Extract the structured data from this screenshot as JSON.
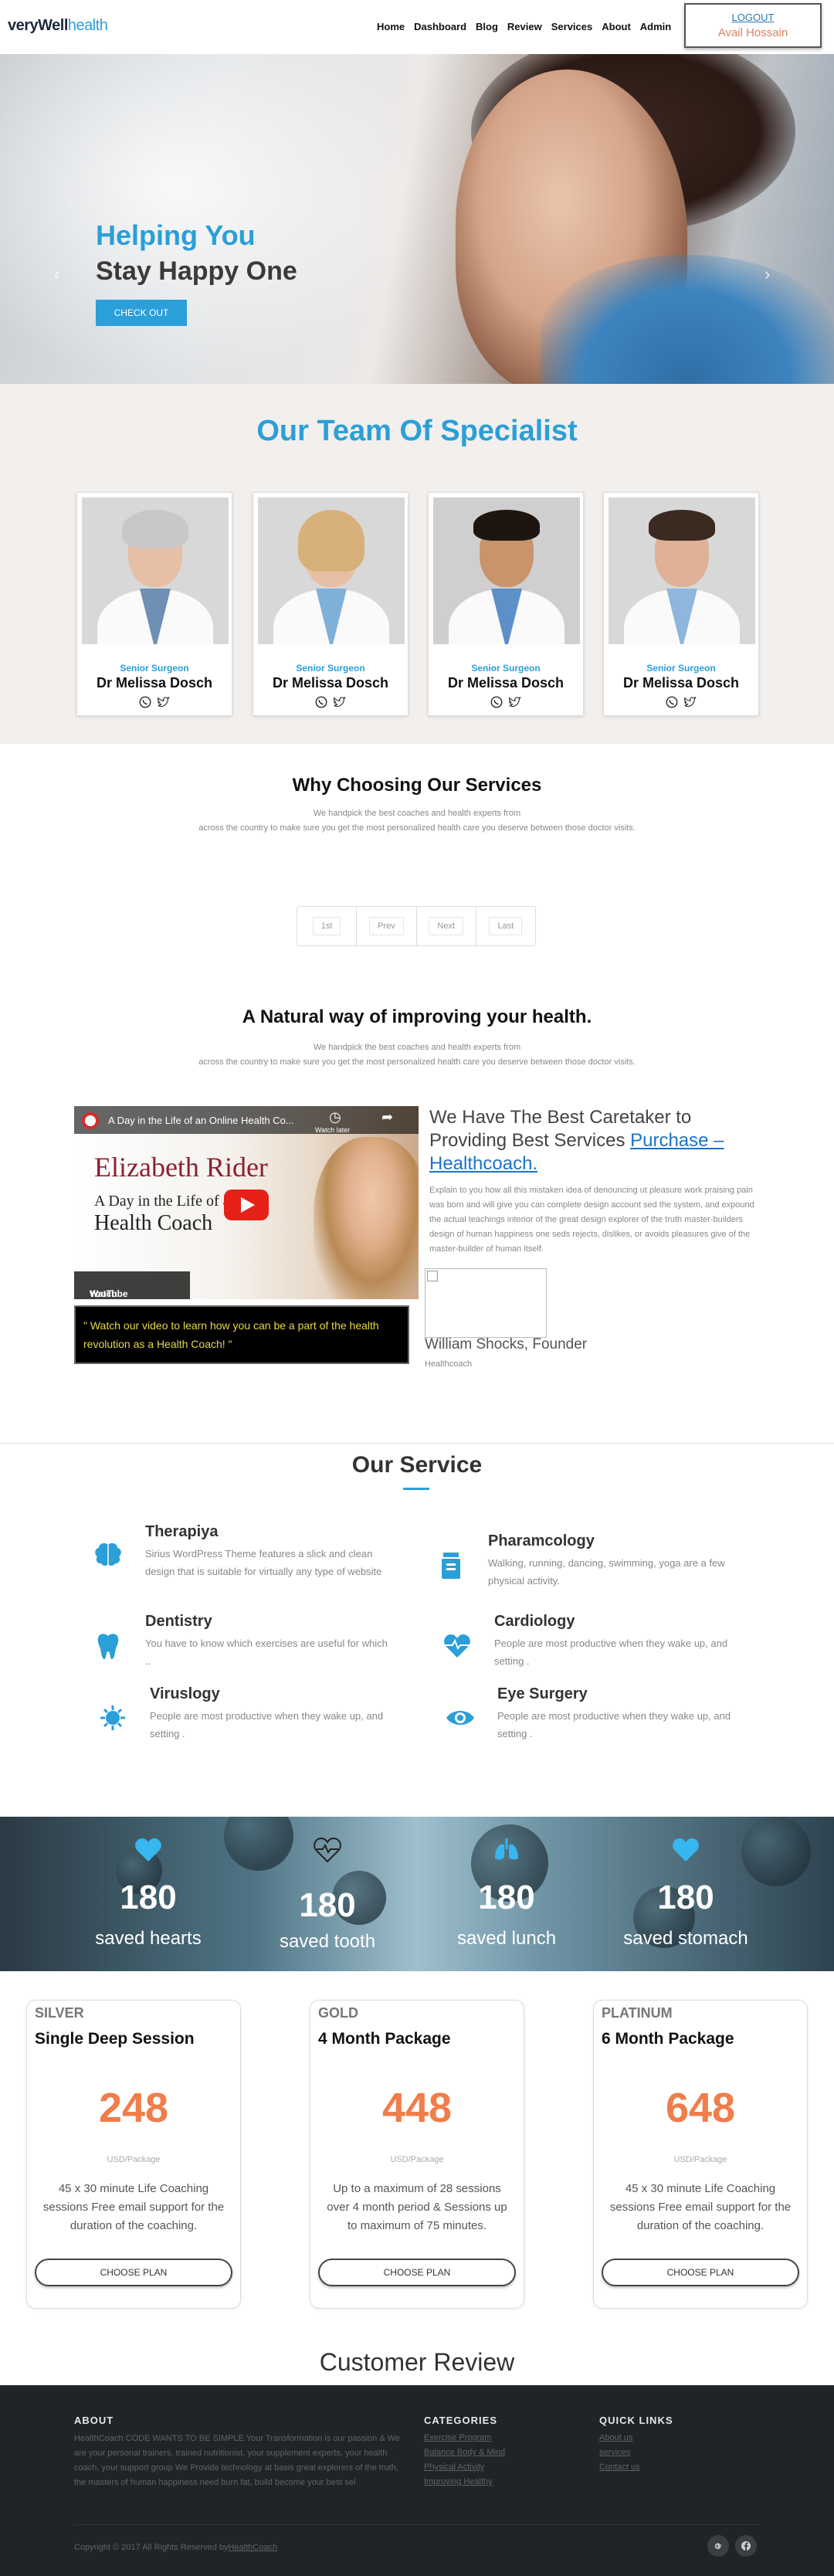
{
  "header": {
    "logo_bold": "veryWell",
    "logo_light": "health",
    "nav": [
      "Home",
      "Dashboard",
      "Blog",
      "Review",
      "Services",
      "About",
      "Admin"
    ],
    "logout": "LOGOUT",
    "user_name": "Avail Hossain"
  },
  "hero": {
    "line1": "Helping You",
    "line2": "Stay Happy One",
    "cta": "CHECK OUT"
  },
  "team": {
    "title": "Our Team Of Specialist",
    "members": [
      {
        "role": "Senior Surgeon",
        "name": "Dr Melissa Dosch"
      },
      {
        "role": "Senior Surgeon",
        "name": "Dr Melissa Dosch"
      },
      {
        "role": "Senior Surgeon",
        "name": "Dr Melissa Dosch"
      },
      {
        "role": "Senior Surgeon",
        "name": "Dr Melissa Dosch"
      }
    ]
  },
  "why": {
    "title": "Why Choosing Our Services",
    "line1": "We handpick the best coaches and health experts from",
    "line2": "across the country to make sure you get the most personalized health care you deserve between those doctor visits."
  },
  "pager": [
    "1st",
    "Prev",
    "Next",
    "Last"
  ],
  "natural": {
    "title": "A Natural way of improving your health.",
    "line1": "We handpick the best coaches and health experts from",
    "line2": "across the country to make sure you get the most personalized health care you deserve between those doctor visits."
  },
  "video": {
    "title": "A Day in the Life of an Online Health Co...",
    "watch_later": "Watch later",
    "overlay_name": "Elizabeth Rider",
    "overlay_sub": "A Day in the Life of a",
    "overlay_main": "Health Coach",
    "watch_on": "Watch on",
    "youtube": "YouTube",
    "quote": "\" Watch our video to learn how you can be a part of the health revolution as a Health Coach! \""
  },
  "caretaker": {
    "heading": "We Have The Best Caretaker to Providing Best Services ",
    "link": "Purchase – Healthcoach.",
    "body": "Explain to you how all this mistaken idea of denouncing ut pleasure work praising pain was born and will give you can complete design account sed the system, and expound the actual teachings interior of the great design explorer of the truth master-builders design of human happiness one seds rejects, dislikes, or avoids pleasures give of the master-builder of human itself.",
    "founder": "William Shocks, Founder",
    "founder_role": "Healthcoach"
  },
  "services": {
    "title": "Our Service",
    "items": [
      {
        "name": "Therapiya",
        "icon": "brain-icon",
        "desc": "Sirius WordPress Theme features a slick and clean design that is suitable for virtually any type of website"
      },
      {
        "name": "Pharamcology",
        "icon": "medicine-bottle-icon",
        "desc": "Walking, running, dancing, swimming, yoga are a few physical activity."
      },
      {
        "name": "Dentistry",
        "icon": "tooth-icon",
        "desc": "You have to know which exercises are useful for which .."
      },
      {
        "name": "Cardiology",
        "icon": "heartbeat-icon",
        "desc": "People are most productive when they wake up, and setting ."
      },
      {
        "name": "Viruslogy",
        "icon": "virus-icon",
        "desc": "People are most productive when they wake up, and setting ."
      },
      {
        "name": "Eye Surgery",
        "icon": "eye-icon",
        "desc": "People are most productive when they wake up, and setting ."
      }
    ]
  },
  "stats": [
    {
      "num": "180",
      "label": "saved hearts",
      "icon": "heart-icon"
    },
    {
      "num": "180",
      "label": "saved tooth",
      "icon": "heart-pulse-icon"
    },
    {
      "num": "180",
      "label": "saved lunch",
      "icon": "lungs-icon"
    },
    {
      "num": "180",
      "label": "saved stomach",
      "icon": "heart-icon"
    }
  ],
  "plans": [
    {
      "tier": "SILVER",
      "name": "Single Deep Session",
      "price": "248",
      "unit": "USD/Package",
      "desc": "45 x 30 minute Life Coaching sessions Free email support for the duration of the coaching.",
      "button": "CHOOSE PLAN"
    },
    {
      "tier": "GOLD",
      "name": "4 Month Package",
      "price": "448",
      "unit": "USD/Package",
      "desc": "Up to a maximum of 28 sessions over 4 month period & Sessions up to maximum of 75 minutes.",
      "button": "CHOOSE PLAN"
    },
    {
      "tier": "PLATINUM",
      "name": "6 Month Package",
      "price": "648",
      "unit": "USD/Package",
      "desc": "45 x 30 minute Life Coaching sessions Free email support for the duration of the coaching.",
      "button": "CHOOSE PLAN"
    }
  ],
  "review_title": "Customer Review",
  "footer": {
    "about_title": "ABOUT",
    "about_text": "HealthCoach CODE WANTS TO BE SIMPLE Your Transformation is our passion & We are your personal trainers, trained nutritionist, your supplement experts, your health coach, your support group We Provide technology at basis great explorers of the truth, the masters of human happiness need burn fat, build become your best sel",
    "categories_title": "CATEGORIES",
    "categories": [
      "Exercise Program",
      "Balance Body & Mind",
      "Physical Activity",
      "Improving Healthy"
    ],
    "quick_title": "QUICK LINKS",
    "quick": [
      "About us",
      "services",
      "Contact us"
    ],
    "copyright": "Copyright © 2017 All Rights Reserved by",
    "copyright_link": "HealthCoach"
  },
  "colors": {
    "accent": "#2a9fd8",
    "price": "#f07d4a",
    "footer_bg": "#202427"
  }
}
